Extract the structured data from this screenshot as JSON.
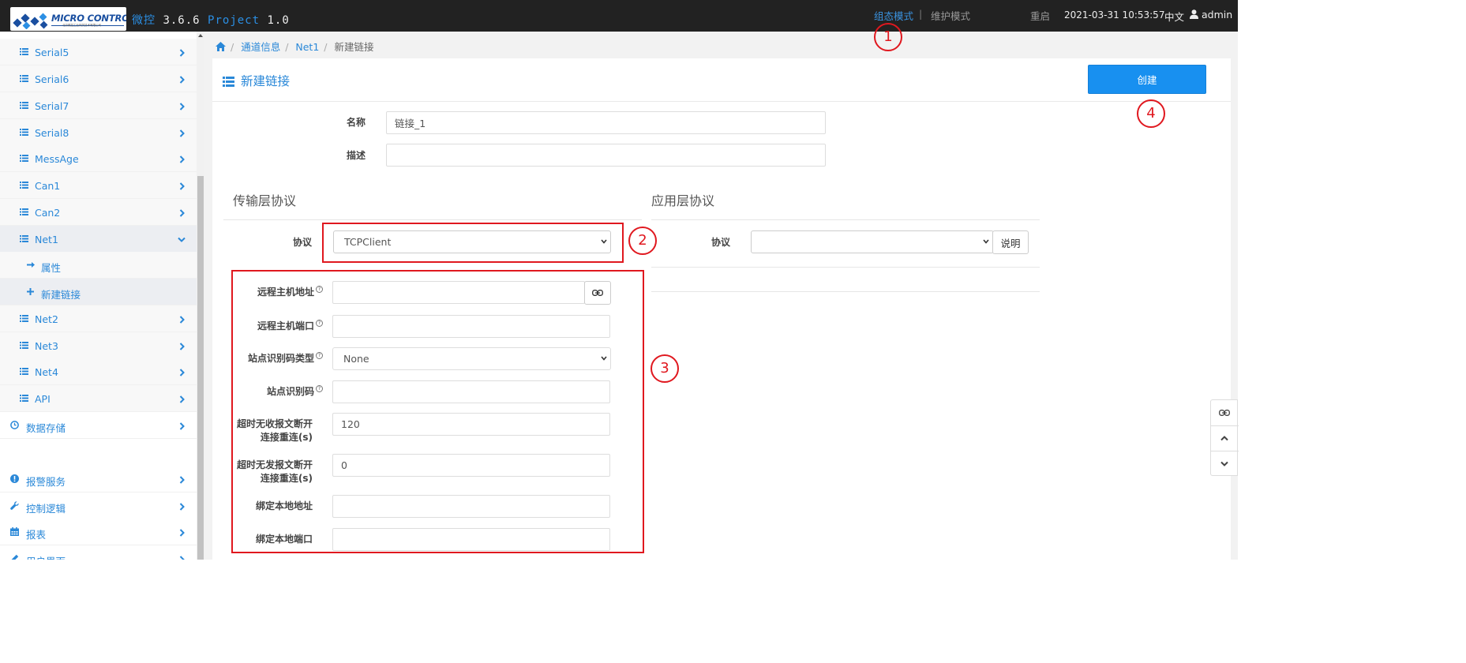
{
  "header": {
    "app_name": "微控",
    "version": "3.6.6",
    "project_label": "Project",
    "project_version": "1.0",
    "logo_text": "MICRO CONTROL",
    "logo_subtext": "北京微控工业网关技术有限公司",
    "mode_config": "组态模式",
    "mode_separator": "|",
    "mode_maintenance": "维护模式",
    "restart": "重启",
    "datetime": "2021-03-31 10:53:57",
    "language": "中文",
    "user": "admin"
  },
  "sidebar": {
    "items": [
      {
        "label": "Serial5",
        "icon": "list-icon"
      },
      {
        "label": "Serial6",
        "icon": "list-icon"
      },
      {
        "label": "Serial7",
        "icon": "list-icon"
      },
      {
        "label": "Serial8",
        "icon": "list-icon"
      },
      {
        "label": "MessAge",
        "icon": "list-icon"
      },
      {
        "label": "Can1",
        "icon": "list-icon"
      },
      {
        "label": "Can2",
        "icon": "list-icon"
      },
      {
        "label": "Net1",
        "icon": "list-icon",
        "expanded": true
      },
      {
        "label": "属性",
        "icon": "arrow-right-icon"
      },
      {
        "label": "新建链接",
        "icon": "plus-icon",
        "active": true
      },
      {
        "label": "Net2",
        "icon": "list-icon"
      },
      {
        "label": "Net3",
        "icon": "list-icon"
      },
      {
        "label": "Net4",
        "icon": "list-icon"
      },
      {
        "label": "API",
        "icon": "list-icon"
      },
      {
        "label": "数据存储",
        "icon": "clock-icon"
      },
      {
        "label": "报警服务",
        "icon": "alert-icon"
      },
      {
        "label": "控制逻辑",
        "icon": "wrench-icon"
      },
      {
        "label": "报表",
        "icon": "calendar-icon"
      },
      {
        "label": "用户界面",
        "icon": "pencil-icon"
      }
    ]
  },
  "breadcrumb": {
    "items": [
      "通道信息",
      "Net1"
    ],
    "current": "新建链接"
  },
  "panel": {
    "title": "新建链接",
    "create_label": "创建"
  },
  "form": {
    "name_label": "名称",
    "name_value": "链接_1",
    "desc_label": "描述",
    "desc_value": "",
    "transport_title": "传输层协议",
    "app_title": "应用层协议",
    "protocol_label": "协议",
    "transport_protocol": "TCPClient",
    "app_protocol_label": "协议",
    "app_protocol": "",
    "explain_label": "说明",
    "remote_host_label": "远程主机地址",
    "remote_host_value": "",
    "remote_port_label": "远程主机端口",
    "remote_port_value": "",
    "station_type_label": "站点识别码类型",
    "station_type_value": "None",
    "station_id_label": "站点识别码",
    "station_id_value": "",
    "recv_timeout_label_1": "超时无收报文断开",
    "recv_timeout_label_2": "连接重连(s)",
    "recv_timeout_value": "120",
    "send_timeout_label_1": "超时无发报文断开",
    "send_timeout_label_2": "连接重连(s)",
    "send_timeout_value": "0",
    "bind_addr_label": "绑定本地地址",
    "bind_addr_value": "",
    "bind_port_label": "绑定本地端口",
    "bind_port_value": "",
    "help_glyph": "?"
  },
  "annotations": [
    "1",
    "2",
    "3",
    "4"
  ],
  "colors": {
    "accent": "#2a88d8",
    "primary_button": "#1890f0",
    "annotation_red": "#e0181f",
    "topbar": "#222222"
  }
}
